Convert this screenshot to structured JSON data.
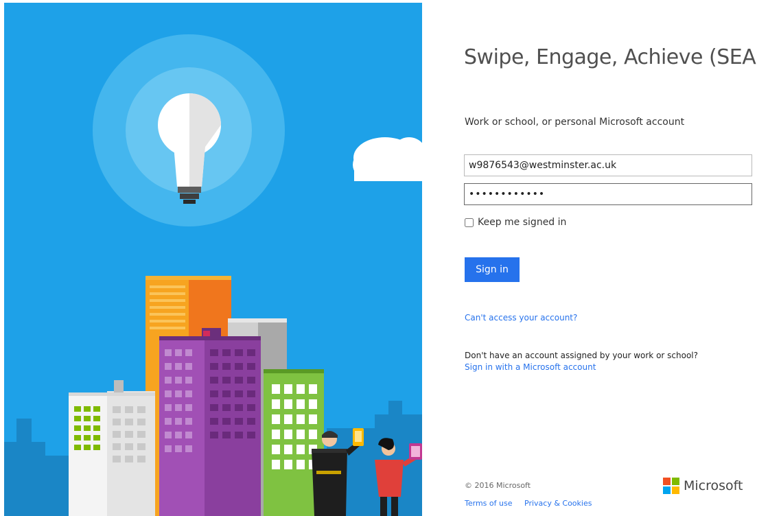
{
  "title": "Swipe, Engage, Achieve (SEA)",
  "account_label": "Work or school, or personal Microsoft account",
  "email_value": "w9876543@westminster.ac.uk",
  "password_value": "••••••••••••",
  "keep_signed_in_label": "Keep me signed in",
  "keep_signed_in_checked": false,
  "sign_in_label": "Sign in",
  "cant_access_link": "Can't access your account?",
  "no_account_text": "Don't have an account assigned by your work or school?",
  "ms_account_link": "Sign in with a Microsoft account",
  "footer": {
    "copyright": "© 2016 Microsoft",
    "terms": "Terms of use",
    "privacy": "Privacy & Cookies",
    "brand": "Microsoft"
  },
  "colors": {
    "accent": "#2672ec",
    "sky": "#1ea1e8",
    "logo_red": "#f25022",
    "logo_green": "#7fba00",
    "logo_blue": "#00a4ef",
    "logo_yellow": "#ffb900"
  }
}
